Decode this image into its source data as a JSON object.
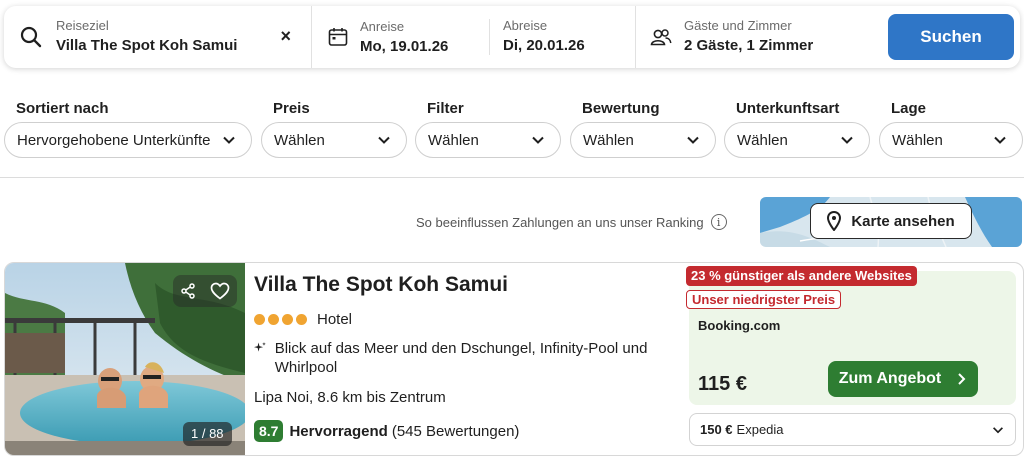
{
  "search": {
    "destination_label": "Reiseziel",
    "destination_value": "Villa The Spot Koh Samui",
    "clear_symbol": "×",
    "checkin_label": "Anreise",
    "checkin_value": "Mo, 19.01.26",
    "checkout_label": "Abreise",
    "checkout_value": "Di, 20.01.26",
    "guests_label": "Gäste und Zimmer",
    "guests_value": "2 Gäste, 1 Zimmer",
    "button_label": "Suchen",
    "button_color": "#2f76c7"
  },
  "filters": [
    {
      "title": "Sortiert nach",
      "value": "Hervorgehobene Unterkünfte"
    },
    {
      "title": "Preis",
      "value": "Wählen"
    },
    {
      "title": "Filter",
      "value": "Wählen"
    },
    {
      "title": "Bewertung",
      "value": "Wählen"
    },
    {
      "title": "Unterkunftsart",
      "value": "Wählen"
    },
    {
      "title": "Lage",
      "value": "Wählen"
    }
  ],
  "ranking_note": "So beeinflussen Zahlungen an uns unser Ranking",
  "info_symbol": "i",
  "map_button_label": "Karte ansehen",
  "hotel": {
    "name": "Villa The Spot Koh Samui",
    "star_count": 4,
    "type": "Hotel",
    "feature": "Blick auf das Meer und den Dschungel, Infinity-Pool und Whirlpool",
    "location": "Lipa Noi, 8.6 km bis Zentrum",
    "score": "8.7",
    "rating_word": "Hervorragend",
    "reviews": "(545 Bewertungen)",
    "photo_counter": "1 / 88"
  },
  "deal": {
    "badge_discount": "23 % günstiger als andere Websites",
    "badge_lowest": "Unser niedrigster Preis",
    "provider": "Booking.com",
    "price": "115 €",
    "button_label": "Zum Angebot",
    "alt_price": "150 €",
    "alt_provider": "Expedia",
    "accent_green": "#2e7d32",
    "badge_red": "#c42a2f"
  }
}
